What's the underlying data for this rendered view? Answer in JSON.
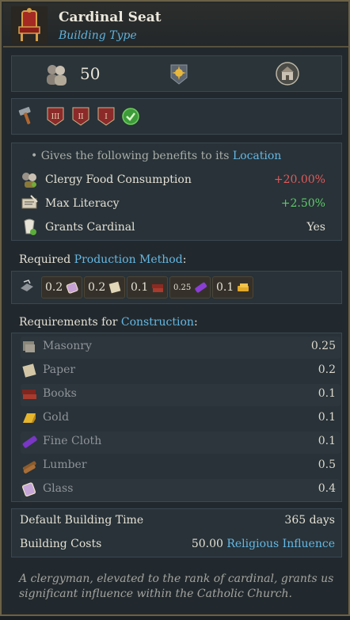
{
  "header": {
    "title": "Cardinal Seat",
    "subtitle": "Building Type"
  },
  "stats": {
    "population": "50"
  },
  "tiers": [
    "III",
    "II",
    "I"
  ],
  "benefits": {
    "intro_prefix": "• Gives the following benefits to its ",
    "intro_link": "Location",
    "rows": [
      {
        "label": "Clergy Food Consumption",
        "value": "+20.00%",
        "icon": "food-icon"
      },
      {
        "label": "Max Literacy",
        "value": "+2.50%",
        "icon": "literacy-icon"
      },
      {
        "label": "Grants Cardinal",
        "value": "Yes",
        "icon": "cardinal-icon"
      }
    ]
  },
  "production": {
    "title_prefix": "Required ",
    "title_link": "Production Method",
    "title_suffix": ":",
    "chips": [
      {
        "value": "0.2",
        "icon": "glass-icon"
      },
      {
        "value": "0.2",
        "icon": "paper-icon"
      },
      {
        "value": "0.1",
        "icon": "books-icon"
      },
      {
        "value": "0.25",
        "icon": "fine-cloth-icon"
      },
      {
        "value": "0.1",
        "icon": "gold-icon"
      }
    ]
  },
  "construction": {
    "title_prefix": "Requirements for ",
    "title_link": "Construction",
    "title_suffix": ":",
    "goods": [
      {
        "name": "Masonry",
        "value": "0.25",
        "icon": "masonry-icon"
      },
      {
        "name": "Paper",
        "value": "0.2",
        "icon": "paper-icon"
      },
      {
        "name": "Books",
        "value": "0.1",
        "icon": "books-icon"
      },
      {
        "name": "Gold",
        "value": "0.1",
        "icon": "gold-icon"
      },
      {
        "name": "Fine Cloth",
        "value": "0.1",
        "icon": "fine-cloth-icon"
      },
      {
        "name": "Lumber",
        "value": "0.5",
        "icon": "lumber-icon"
      },
      {
        "name": "Glass",
        "value": "0.4",
        "icon": "glass-icon"
      }
    ]
  },
  "summary": {
    "time_label": "Default Building Time",
    "time_value": "365 days",
    "cost_label": "Building Costs",
    "cost_amount": "50.00",
    "cost_currency": "Religious Influence"
  },
  "flavor": "A clergyman, elevated to the rank of cardinal, grants us significant influence within the Catholic Church.",
  "colors": {
    "accent": "#64b8e4",
    "negative": "#e05b5b",
    "positive": "#5fcc6a",
    "border": "#6b6148"
  }
}
